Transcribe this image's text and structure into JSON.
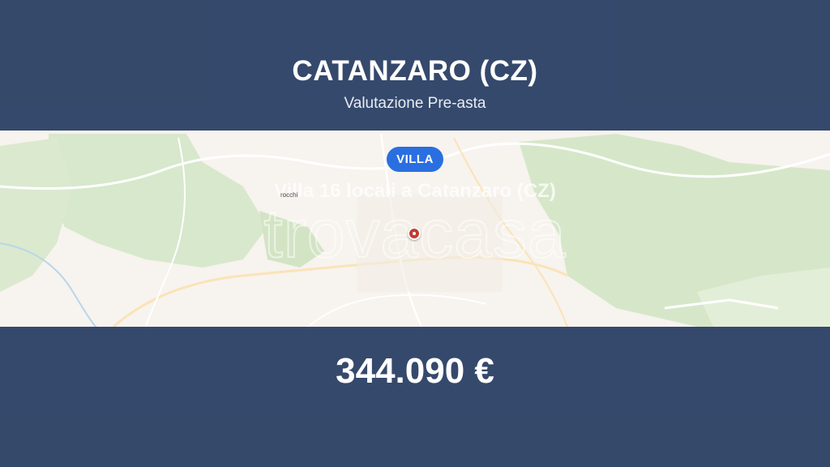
{
  "header": {
    "title": "CATANZARO (CZ)",
    "subtitle": "Valutazione Pre-asta"
  },
  "badge": {
    "label": "VILLA",
    "color": "#2a6fe0"
  },
  "listing": {
    "title": "Villa 16 locali a Catanzaro (CZ)"
  },
  "watermark": {
    "text": "trovacasa"
  },
  "map": {
    "town_label": "rocchi",
    "marker_icon": "map-pin-icon"
  },
  "footer": {
    "price": "344.090 €"
  },
  "colors": {
    "band": "#2d4266",
    "map_land": "#f7f3ee",
    "map_green": "#d8e8cc"
  }
}
